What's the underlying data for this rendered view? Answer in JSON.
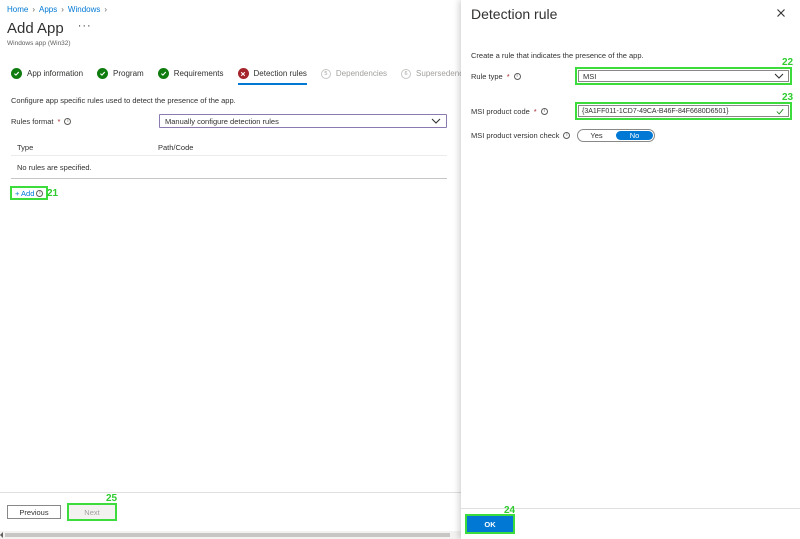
{
  "breadcrumb": {
    "items": [
      "Home",
      "Apps",
      "Windows"
    ]
  },
  "page": {
    "title": "Add App",
    "more": "···",
    "subtitle": "Windows app (Win32)"
  },
  "steps": [
    {
      "label": "App information",
      "state": "done"
    },
    {
      "label": "Program",
      "state": "done"
    },
    {
      "label": "Requirements",
      "state": "done"
    },
    {
      "label": "Detection rules",
      "state": "error"
    },
    {
      "label": "Dependencies",
      "state": "future",
      "number": "5"
    },
    {
      "label": "Supersedence",
      "state": "future",
      "number": "6"
    }
  ],
  "detection": {
    "description": "Configure app specific rules used to detect the presence of the app.",
    "rules_format_label": "Rules format",
    "rules_format_value": "Manually configure detection rules",
    "columns": [
      "Type",
      "Path/Code"
    ],
    "empty_text": "No rules are specified.",
    "add_label": "+ Add"
  },
  "footer": {
    "previous": "Previous",
    "next": "Next"
  },
  "panel": {
    "title": "Detection rule",
    "description": "Create a rule that indicates the presence of the app.",
    "rule_type_label": "Rule type",
    "rule_type_value": "MSI",
    "product_code_label": "MSI product code",
    "product_code_value": "{3A1FF011-1CD7-49CA-B46F-84F6680D6501}",
    "version_check_label": "MSI product version check",
    "toggle_yes": "Yes",
    "toggle_no": "No",
    "toggle_selected": "No",
    "ok": "OK"
  },
  "annotations": {
    "add": "21",
    "rule_type": "22",
    "product_code": "23",
    "ok": "24",
    "next": "25"
  },
  "colors": {
    "accent": "#0078d4",
    "success": "#107c10",
    "error": "#a4262c",
    "highlight": "#3ddc3d"
  }
}
